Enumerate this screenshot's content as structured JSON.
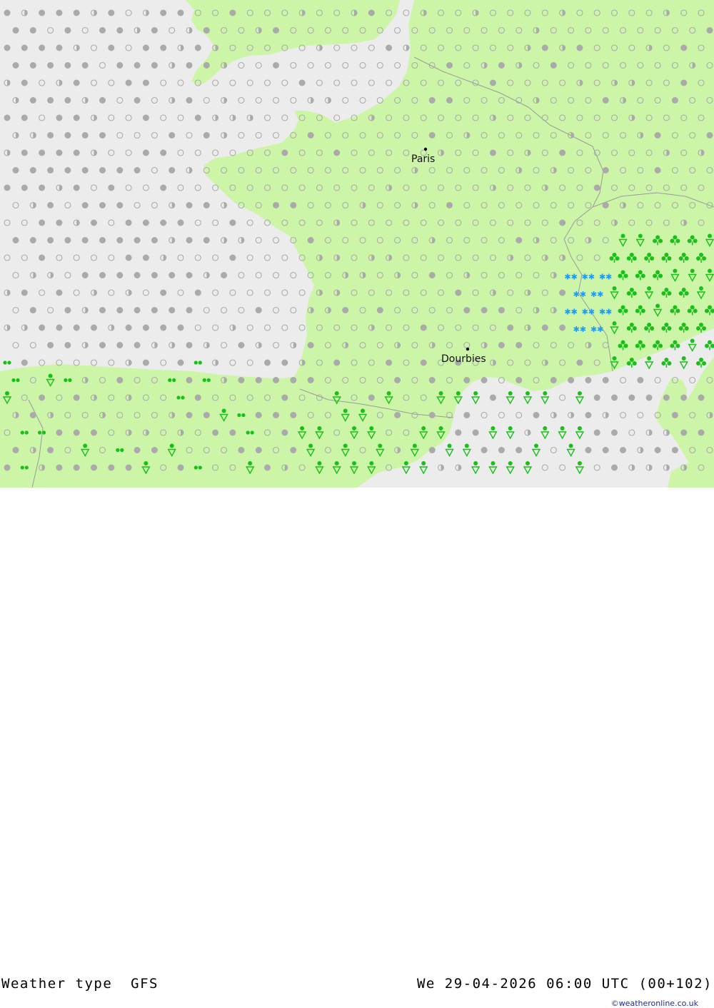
{
  "map": {
    "title": "Weather type",
    "model": "GFS",
    "valid_time": "We 29-04-2026 06:00 UTC (00+102)",
    "credit": "©weatheronline.co.uk",
    "colors": {
      "sea": "#ececec",
      "land": "#ccf5a8",
      "cloud_symbol": "#aaaaaa",
      "rain_symbol": "#18c018",
      "snow_symbol": "#1a9cff"
    },
    "cities": [
      {
        "name": "Paris",
        "lon": 2.35,
        "lat": 48.86
      },
      {
        "name": "Dourbies",
        "lon": 3.45,
        "lat": 44.08
      }
    ]
  }
}
